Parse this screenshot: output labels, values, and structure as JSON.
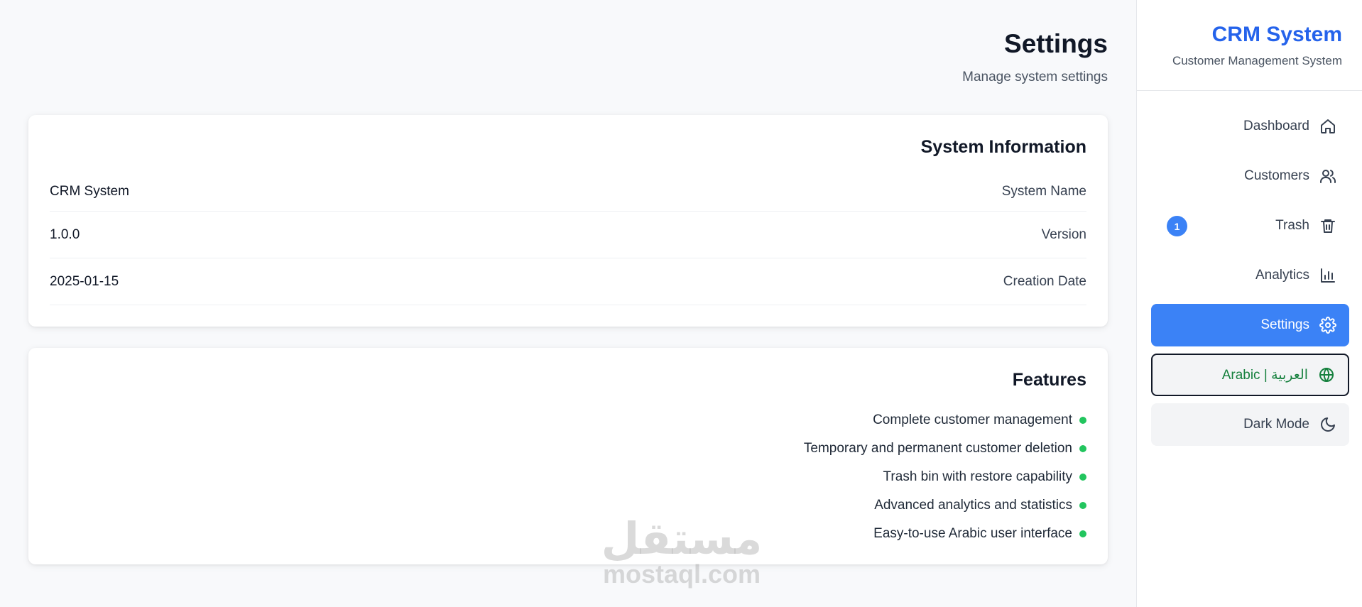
{
  "header": {
    "title": "Settings",
    "subtitle": "Manage system settings"
  },
  "system_info": {
    "title": "System Information",
    "rows": [
      {
        "value": "CRM System",
        "label": "System Name"
      },
      {
        "value": "1.0.0",
        "label": "Version"
      },
      {
        "value": "2025-01-15",
        "label": "Creation Date"
      }
    ]
  },
  "features": {
    "title": "Features",
    "items": [
      "Complete customer management",
      "Temporary and permanent customer deletion",
      "Trash bin with restore capability",
      "Advanced analytics and statistics",
      "Easy-to-use Arabic user interface"
    ]
  },
  "sidebar": {
    "brand_title": "CRM System",
    "brand_subtitle": "Customer Management System",
    "items": [
      {
        "label": "Dashboard",
        "icon": "home-icon"
      },
      {
        "label": "Customers",
        "icon": "users-icon"
      },
      {
        "label": "Trash",
        "icon": "trash-icon",
        "badge": "1"
      },
      {
        "label": "Analytics",
        "icon": "bar-chart-icon"
      },
      {
        "label": "Settings",
        "icon": "gear-icon",
        "active": true
      }
    ],
    "language_toggle": "Arabic | العربية",
    "dark_mode_toggle": "Dark Mode"
  },
  "watermark": {
    "arabic": "مستقل",
    "latin": "mostaql.com"
  },
  "colors": {
    "accent": "#3b82f6",
    "brand": "#2563eb",
    "feature_dot": "#22c55e",
    "language_text": "#15803d"
  }
}
